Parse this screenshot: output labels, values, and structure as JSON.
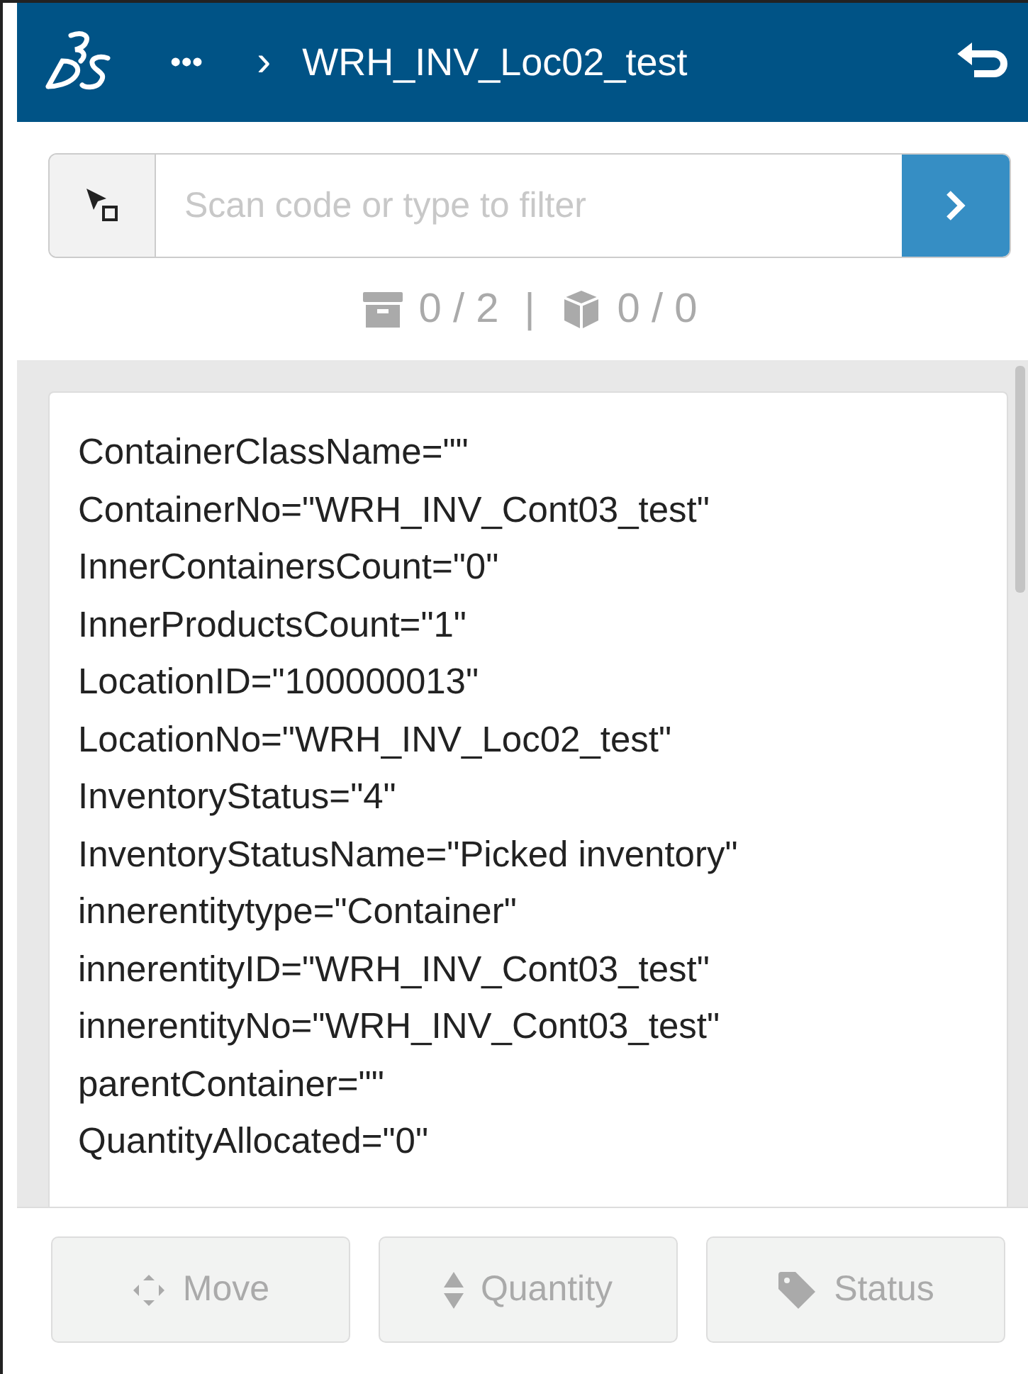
{
  "header": {
    "breadcrumb_more": "•••",
    "breadcrumb_separator": "›",
    "title": "WRH_INV_Loc02_test"
  },
  "search": {
    "placeholder": "Scan code or type to filter"
  },
  "counts": {
    "containers": "0 / 2",
    "separator": "|",
    "products": "0 / 0"
  },
  "details": [
    "ContainerClassName=\"\"",
    "ContainerNo=\"WRH_INV_Cont03_test\"",
    "InnerContainersCount=\"0\"",
    "InnerProductsCount=\"1\"",
    "LocationID=\"100000013\"",
    "LocationNo=\"WRH_INV_Loc02_test\"",
    "InventoryStatus=\"4\"",
    "InventoryStatusName=\"Picked inventory\"",
    "innerentitytype=\"Container\"",
    "innerentityID=\"WRH_INV_Cont03_test\"",
    "innerentityNo=\"WRH_INV_Cont03_test\"",
    "parentContainer=\"\"",
    "QuantityAllocated=\"0\""
  ],
  "actions": [
    {
      "label": "Move",
      "kind": "move",
      "disabled": true
    },
    {
      "label": "Quantity",
      "kind": "quantity",
      "disabled": true
    },
    {
      "label": "Status",
      "kind": "status",
      "disabled": true
    }
  ]
}
